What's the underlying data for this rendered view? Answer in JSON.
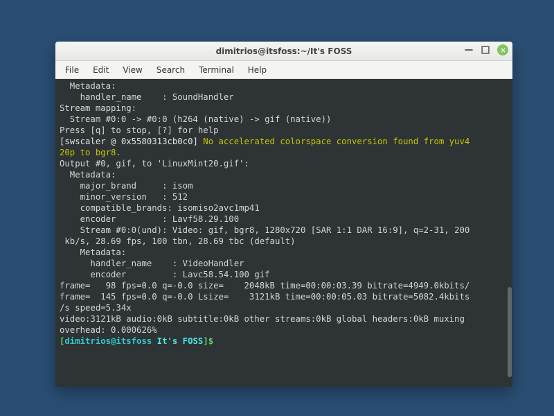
{
  "title": "dimitrios@itsfoss:~/It's FOSS",
  "menu": [
    "File",
    "Edit",
    "View",
    "Search",
    "Terminal",
    "Help"
  ],
  "t": {
    "l1": "  Metadata:",
    "l2": "    handler_name    : SoundHandler",
    "l3": "Stream mapping:",
    "l4": "  Stream #0:0 -> #0:0 (h264 (native) -> gif (native))",
    "l5": "Press [q] to stop, [?] for help",
    "l6a": "[swscaler @ 0x5580313cb0c0]",
    "l6b": " No accelerated colorspace conversion found from yuv4",
    "l7": "20p to bgr8.",
    "l8": "Output #0, gif, to 'LinuxMint20.gif':",
    "l9": "  Metadata:",
    "l10": "    major_brand     : isom",
    "l11": "    minor_version   : 512",
    "l12": "    compatible_brands: isomiso2avc1mp41",
    "l13": "    encoder         : Lavf58.29.100",
    "l14": "    Stream #0:0(und): Video: gif, bgr8, 1280x720 [SAR 1:1 DAR 16:9], q=2-31, 200",
    "l15": " kb/s, 28.69 fps, 100 tbn, 28.69 tbc (default)",
    "l16": "    Metadata:",
    "l17": "      handler_name    : VideoHandler",
    "l18": "      encoder         : Lavc58.54.100 gif",
    "l19": "frame=   98 fps=0.0 q=-0.0 size=    2048kB time=00:00:03.39 bitrate=4949.0kbits/",
    "l20": "frame=  145 fps=0.0 q=-0.0 Lsize=    3121kB time=00:00:05.03 bitrate=5082.4kbits",
    "l21": "/s speed=5.34x",
    "l22": "video:3121kB audio:0kB subtitle:0kB other streams:0kB global headers:0kB muxing ",
    "l23": "overhead: 0.000626%",
    "p_bo": "[",
    "p_user": "dimitrios@itsfoss",
    "p_dir": " It's FOSS",
    "p_bc": "]$"
  }
}
